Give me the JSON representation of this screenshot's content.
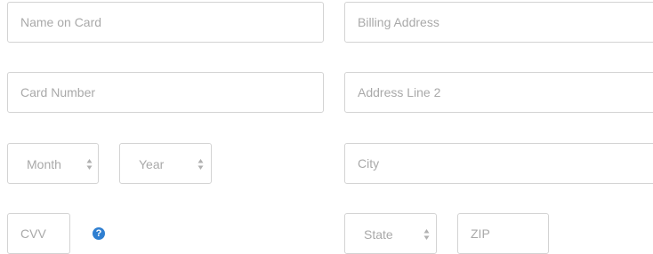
{
  "payment": {
    "name_on_card_placeholder": "Name on Card",
    "card_number_placeholder": "Card Number",
    "month_label": "Month",
    "year_label": "Year",
    "cvv_placeholder": "CVV",
    "cvv_help_icon": "question-circle-icon",
    "cvv_help_glyph": "?"
  },
  "billing": {
    "billing_address_placeholder": "Billing Address",
    "address_line2_placeholder": "Address Line 2",
    "city_placeholder": "City",
    "state_label": "State",
    "zip_placeholder": "ZIP"
  },
  "colors": {
    "border": "#d3d3d3",
    "placeholder_text": "#a9a9a9",
    "help_icon": "#2f7fd1"
  }
}
